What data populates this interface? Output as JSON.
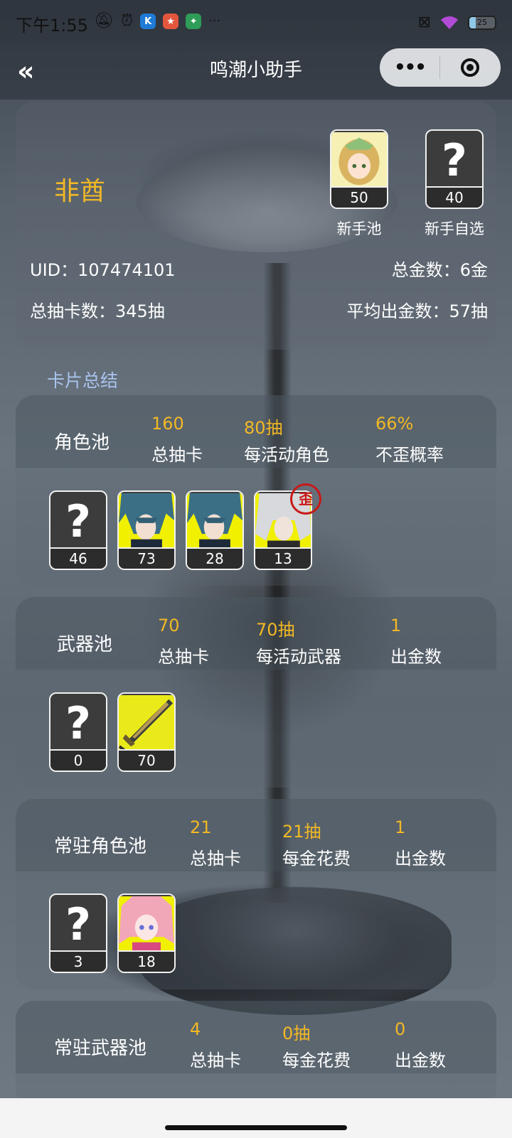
{
  "status_bar": {
    "time": "下午1:55",
    "more": "···",
    "battery": "25",
    "app_icons": [
      {
        "label": "K",
        "color": "#1f7ad6"
      },
      {
        "label": "★",
        "color": "#e2563d"
      },
      {
        "label": "✦",
        "color": "#2f9c57"
      }
    ]
  },
  "nav": {
    "back": "«",
    "title": "鸣潮小助手",
    "more": "•••"
  },
  "profile": {
    "nickname": "非酋",
    "novice_pool": {
      "count": "50",
      "label": "新手池"
    },
    "novice_select": {
      "count": "40",
      "label": "新手自选",
      "unknown_mark": "?"
    },
    "uid": "UID：107474101",
    "total_gold": "总金数：6金",
    "total_pulls": "总抽卡数：345抽",
    "avg_gold": "平均出金数：57抽"
  },
  "section_title": "卡片总结",
  "pools": [
    {
      "name": "角色池",
      "stats": [
        {
          "value": "160",
          "label": "总抽卡"
        },
        {
          "value": "80抽",
          "label": "每活动角色"
        },
        {
          "value": "66%",
          "label": "不歪概率"
        }
      ],
      "tiles": [
        {
          "kind": "unknown",
          "mark": "?",
          "count": "46"
        },
        {
          "kind": "char-blue",
          "count": "73"
        },
        {
          "kind": "char-blue",
          "count": "28"
        },
        {
          "kind": "char-white",
          "count": "13",
          "badge": "歪"
        }
      ]
    },
    {
      "name": "武器池",
      "stats": [
        {
          "value": "70",
          "label": "总抽卡"
        },
        {
          "value": "70抽",
          "label": "每活动武器"
        },
        {
          "value": "1",
          "label": "出金数"
        }
      ],
      "tiles": [
        {
          "kind": "unknown",
          "mark": "?",
          "count": "0"
        },
        {
          "kind": "weapon",
          "count": "70"
        }
      ]
    },
    {
      "name": "常驻角色池",
      "stats": [
        {
          "value": "21",
          "label": "总抽卡"
        },
        {
          "value": "21抽",
          "label": "每金花费"
        },
        {
          "value": "1",
          "label": "出金数"
        }
      ],
      "tiles": [
        {
          "kind": "unknown",
          "mark": "?",
          "count": "3"
        },
        {
          "kind": "char-pink",
          "count": "18"
        }
      ]
    },
    {
      "name": "常驻武器池",
      "stats": [
        {
          "value": "4",
          "label": "总抽卡"
        },
        {
          "value": "0抽",
          "label": "每金花费"
        },
        {
          "value": "0",
          "label": "出金数"
        }
      ],
      "tiles": []
    }
  ],
  "colors": {
    "accent_gold": "#f2b825",
    "section_blue": "#a9c3ee",
    "badge_red": "#c81818"
  }
}
